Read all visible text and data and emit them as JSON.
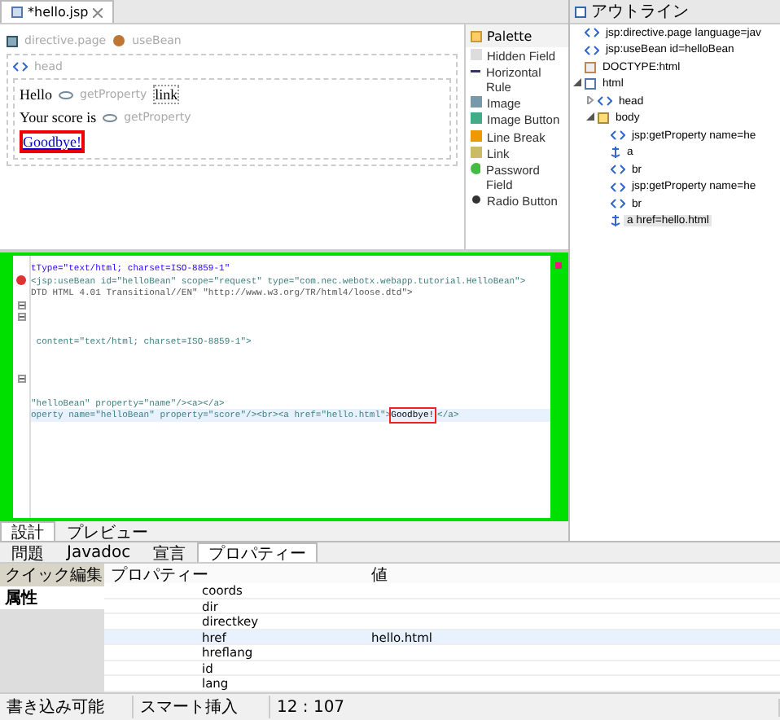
{
  "editor": {
    "tab": {
      "title": "*hello.jsp",
      "dirty": true
    },
    "design": {
      "directive": "directive.page",
      "bean": "useBean",
      "head": "head",
      "line1": {
        "text": "Hello",
        "prop": "getProperty",
        "link": "link"
      },
      "line2": {
        "text": "Your score is",
        "prop": "getProperty"
      },
      "goodbye": "Goodbye!"
    },
    "palette": {
      "title": "Palette",
      "items": [
        {
          "label": "Hidden Field",
          "kind": "field"
        },
        {
          "label": "Horizontal Rule",
          "kind": "rule"
        },
        {
          "label": "Image",
          "kind": "image"
        },
        {
          "label": "Image Button",
          "kind": "imagebutton"
        },
        {
          "label": "Line Break",
          "kind": "break"
        },
        {
          "label": "Link",
          "kind": "link"
        },
        {
          "label": "Password Field",
          "kind": "password"
        },
        {
          "label": "Radio Button",
          "kind": "radio"
        }
      ]
    },
    "source": {
      "lines": [
        {
          "kind": "text",
          "segments": [
            {
              "text": "tType=\"text/html; charset=ISO-8859-1\"",
              "kind": "string"
            }
          ]
        },
        {
          "kind": "error",
          "segments": [
            {
              "text": "<jsp:useBean id=\"helloBean\" scope=\"request\" type=\"com.nec.webotx.webapp.tutorial.HelloBean\">",
              "kind": "tag"
            }
          ]
        },
        {
          "kind": "text",
          "segments": [
            {
              "text": "DTD HTML 4.01 Transitional//EN\" \"http://www.w3.org/TR/html4/loose.dtd\">",
              "kind": "plain"
            }
          ]
        },
        {
          "kind": "fold"
        },
        {
          "kind": "fold"
        },
        {
          "kind": "blank"
        },
        {
          "kind": "text",
          "segments": [
            {
              "text": " content=\"text/html; charset=ISO-8859-1\">",
              "kind": "tag"
            }
          ]
        },
        {
          "kind": "blank"
        },
        {
          "kind": "blank"
        },
        {
          "kind": "fold"
        },
        {
          "kind": "blank"
        },
        {
          "kind": "text",
          "segments": [
            {
              "text": "\"helloBean\" property=\"name\"/><a></a>",
              "kind": "tag"
            }
          ]
        },
        {
          "kind": "text",
          "segments": [
            {
              "text": "operty name=\"helloBean\" property=\"score\"/><br><a href=\"hello.html\">",
              "kind": "tag"
            },
            {
              "text": "Goodbye!",
              "kind": "boxed"
            },
            {
              "text": "</a>",
              "kind": "tag"
            }
          ],
          "current": true
        }
      ]
    },
    "modes": [
      {
        "label": "設計",
        "selected": true
      },
      {
        "label": "プレビュー",
        "selected": false
      }
    ]
  },
  "outline": {
    "title": "アウトライン",
    "items": [
      {
        "label": "jsp:directive.page language=jav",
        "kind": "tag",
        "selected": false
      },
      {
        "label": "jsp:useBean id=helloBean",
        "kind": "tag",
        "selected": false
      },
      {
        "label": "DOCTYPE:html",
        "kind": "doctype",
        "selected": false
      },
      {
        "label": "html",
        "kind": "doc",
        "selected": false,
        "expanded": true,
        "children": [
          {
            "label": "head",
            "kind": "tag",
            "selected": false,
            "expanded": false
          },
          {
            "label": "body",
            "kind": "body",
            "selected": false,
            "expanded": true,
            "children": [
              {
                "label": "jsp:getProperty name=he",
                "kind": "tag",
                "selected": false
              },
              {
                "label": "a",
                "kind": "anchor",
                "selected": false
              },
              {
                "label": "br",
                "kind": "tag",
                "selected": false
              },
              {
                "label": "jsp:getProperty name=he",
                "kind": "tag",
                "selected": false
              },
              {
                "label": "br",
                "kind": "tag",
                "selected": false
              },
              {
                "label": "a href=hello.html",
                "kind": "anchor",
                "selected": true
              }
            ]
          }
        ]
      }
    ]
  },
  "views": {
    "tabs": [
      {
        "label": "問題",
        "selected": false
      },
      {
        "label": "Javadoc",
        "selected": false
      },
      {
        "label": "宣言",
        "selected": false
      },
      {
        "label": "プロパティー",
        "selected": true
      }
    ],
    "side_tabs": [
      {
        "label": "クイック編集",
        "selected": false
      },
      {
        "label": "属性",
        "selected": true
      }
    ],
    "columns": [
      "プロパティー",
      "値"
    ],
    "rows": [
      {
        "name": "coords",
        "selected": false
      },
      {
        "name": "dir",
        "selected": false
      },
      {
        "name": "directkey",
        "selected": false
      },
      {
        "name": "href",
        "value": "hello.html",
        "selected": true
      },
      {
        "name": "hreflang",
        "selected": false
      },
      {
        "name": "id",
        "selected": false
      },
      {
        "name": "lang",
        "selected": false
      }
    ]
  },
  "status_bar": [
    "書き込み可能",
    "スマート挿入",
    "12 : 107"
  ]
}
